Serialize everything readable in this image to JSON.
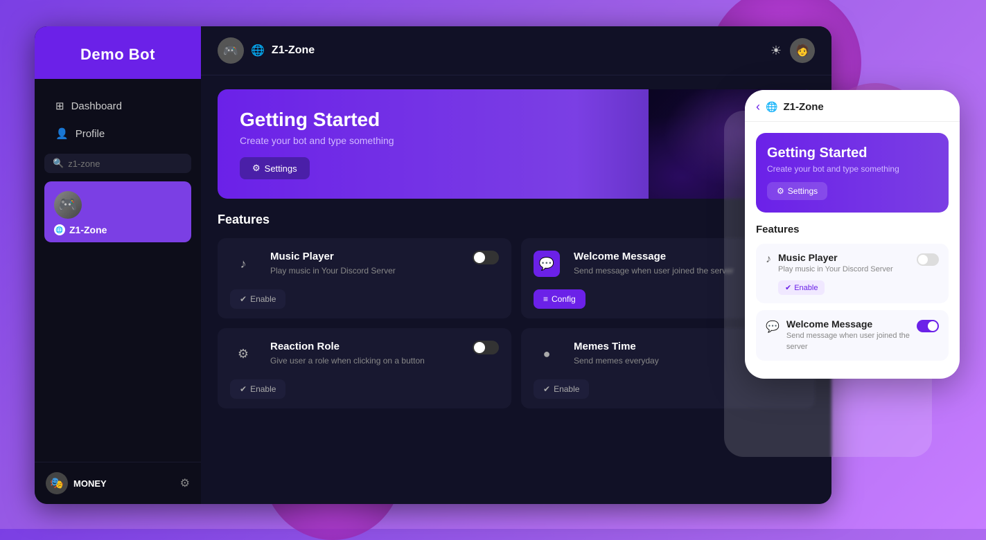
{
  "app": {
    "title": "Demo Bot",
    "bg_color": "#7b3fe4"
  },
  "sidebar": {
    "title": "Demo Bot",
    "nav_items": [
      {
        "id": "dashboard",
        "label": "Dashboard",
        "icon": "⊞"
      },
      {
        "id": "profile",
        "label": "Profile",
        "icon": "👤"
      }
    ],
    "search_placeholder": "z1-zone",
    "server": {
      "name": "Z1-Zone",
      "globe_icon": "🌐"
    },
    "footer": {
      "username": "MONEY",
      "gear_icon": "⚙"
    }
  },
  "topbar": {
    "server_name": "Z1-Zone",
    "globe_icon": "🌐",
    "sun_icon": "☀",
    "avatar_icon": "👤"
  },
  "banner": {
    "title": "Getting Started",
    "subtitle": "Create your bot and type something",
    "settings_btn": "Settings",
    "settings_icon": "⚙"
  },
  "features": {
    "section_title": "Features",
    "items": [
      {
        "id": "music-player",
        "title": "Music Player",
        "desc": "Play music in Your Discord Server",
        "icon": "♪",
        "icon_bg": "transparent",
        "toggle": false,
        "btn_label": "Enable",
        "btn_icon": "✔",
        "btn_style": "normal"
      },
      {
        "id": "welcome-message",
        "title": "Welcome Message",
        "desc": "Send message when user joined the server",
        "icon": "💬",
        "icon_bg": "purple",
        "toggle": true,
        "btn_label": "Config",
        "btn_icon": "≡",
        "btn_style": "purple"
      },
      {
        "id": "reaction-role",
        "title": "Reaction Role",
        "desc": "Give user a role when clicking on a button",
        "icon": "⚙",
        "icon_bg": "transparent",
        "toggle": false,
        "btn_label": "Enable",
        "btn_icon": "✔",
        "btn_style": "normal"
      },
      {
        "id": "memes-time",
        "title": "Memes Time",
        "desc": "Send memes everyday",
        "icon": "●",
        "icon_bg": "transparent",
        "toggle": false,
        "btn_label": "Enable",
        "btn_icon": "✔",
        "btn_style": "normal"
      }
    ]
  },
  "mobile": {
    "server_name": "Z1-Zone",
    "back_icon": "‹",
    "globe_icon": "🌐",
    "getting_started": {
      "title": "Getting Started",
      "subtitle": "Create your bot and type something",
      "settings_btn": "Settings",
      "settings_icon": "⚙"
    },
    "features_title": "Features",
    "features": [
      {
        "id": "music-player",
        "title": "Music Player",
        "desc": "Play music in Your Discord Server",
        "icon": "♪",
        "toggle": false,
        "enable_label": "Enable",
        "enable_icon": "✔"
      },
      {
        "id": "welcome-message",
        "title": "Welcome Message",
        "desc": "Send message when user joined the server",
        "icon": "💬",
        "toggle": true
      }
    ]
  }
}
